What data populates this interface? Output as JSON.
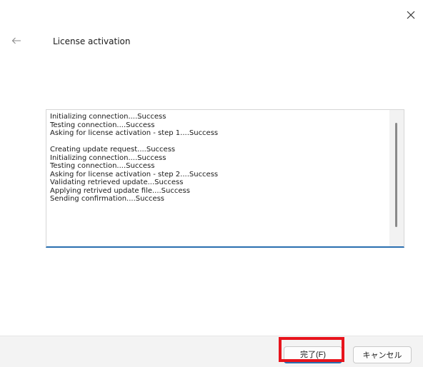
{
  "dialog": {
    "title": "License activation",
    "close_icon": "close-icon",
    "back_icon": "back-arrow-icon"
  },
  "log": {
    "lines": [
      "Initializing connection....Success",
      "Testing connection....Success",
      "Asking for license activation - step 1....Success",
      "",
      "Creating update request....Success",
      "Initializing connection....Success",
      "Testing connection....Success",
      "Asking for license activation - step 2....Success",
      "Validating retrieved update...Success",
      "Applying retrived update file....Success",
      "Sending confirmation....Success"
    ]
  },
  "buttons": {
    "finish_label": "完了(F)",
    "cancel_label": "キャンセル"
  },
  "colors": {
    "accent": "#2a6fb0",
    "highlight": "#e8141c",
    "footer_bg": "#f3f3f3"
  }
}
